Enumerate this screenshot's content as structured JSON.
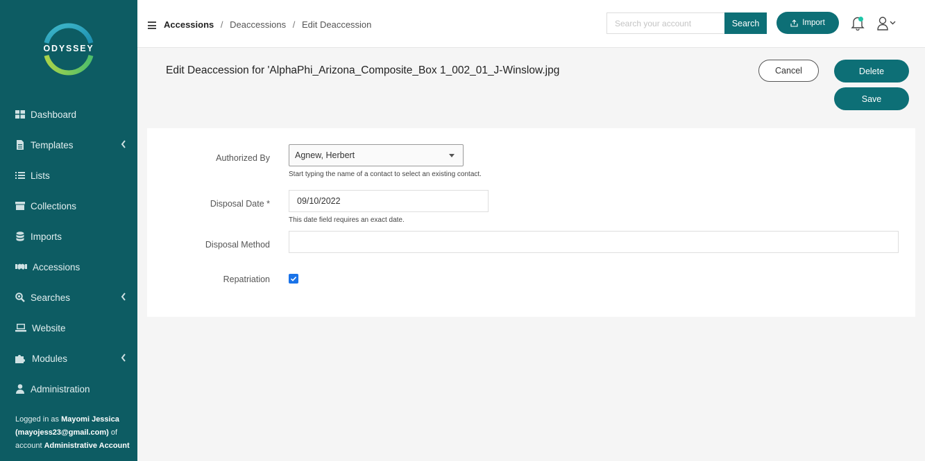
{
  "brand": {
    "name": "ODYSSEY"
  },
  "sidebar": {
    "items": [
      {
        "label": "Dashboard",
        "icon": "dashboard-icon",
        "submenu": false
      },
      {
        "label": "Templates",
        "icon": "file-icon",
        "submenu": true
      },
      {
        "label": "Lists",
        "icon": "list-icon",
        "submenu": false
      },
      {
        "label": "Collections",
        "icon": "archive-icon",
        "submenu": false
      },
      {
        "label": "Imports",
        "icon": "database-icon",
        "submenu": false
      },
      {
        "label": "Accessions",
        "icon": "handshake-icon",
        "submenu": false
      },
      {
        "label": "Searches",
        "icon": "search-icon",
        "submenu": true
      },
      {
        "label": "Website",
        "icon": "laptop-icon",
        "submenu": false
      },
      {
        "label": "Modules",
        "icon": "puzzle-icon",
        "submenu": true
      },
      {
        "label": "Administration",
        "icon": "user-icon",
        "submenu": false
      }
    ],
    "login": {
      "prefix": "Logged in as",
      "name": "Mayomi Jessica",
      "email": "(mayojess23@gmail.com)",
      "of_account": "of account",
      "account": "Administrative Account"
    }
  },
  "topbar": {
    "breadcrumb": [
      "Accessions",
      "Deaccessions",
      "Edit Deaccession"
    ],
    "breadcrumb_sep": "/",
    "search_placeholder": "Search your account",
    "search_label": "Search",
    "import_label": "Import"
  },
  "page": {
    "title": "Edit Deaccession for 'AlphaPhi_Arizona_Composite_Box 1_002_01_J-Winslow.jpg",
    "cancel_label": "Cancel",
    "delete_label": "Delete",
    "save_label": "Save"
  },
  "form": {
    "authorized_by": {
      "label": "Authorized By",
      "value": "Agnew, Herbert",
      "hint": "Start typing the name of a contact to select an existing contact."
    },
    "disposal_date": {
      "label": "Disposal Date *",
      "value": "09/10/2022",
      "hint": "This date field requires an exact date."
    },
    "disposal_method": {
      "label": "Disposal Method",
      "value": ""
    },
    "repatriation": {
      "label": "Repatriation",
      "checked": true
    }
  },
  "colors": {
    "sidebar_bg": "#0d5c63",
    "accent": "#0d6f76",
    "checkbox": "#1a73e8",
    "notification_dot": "#1ec6a8"
  }
}
